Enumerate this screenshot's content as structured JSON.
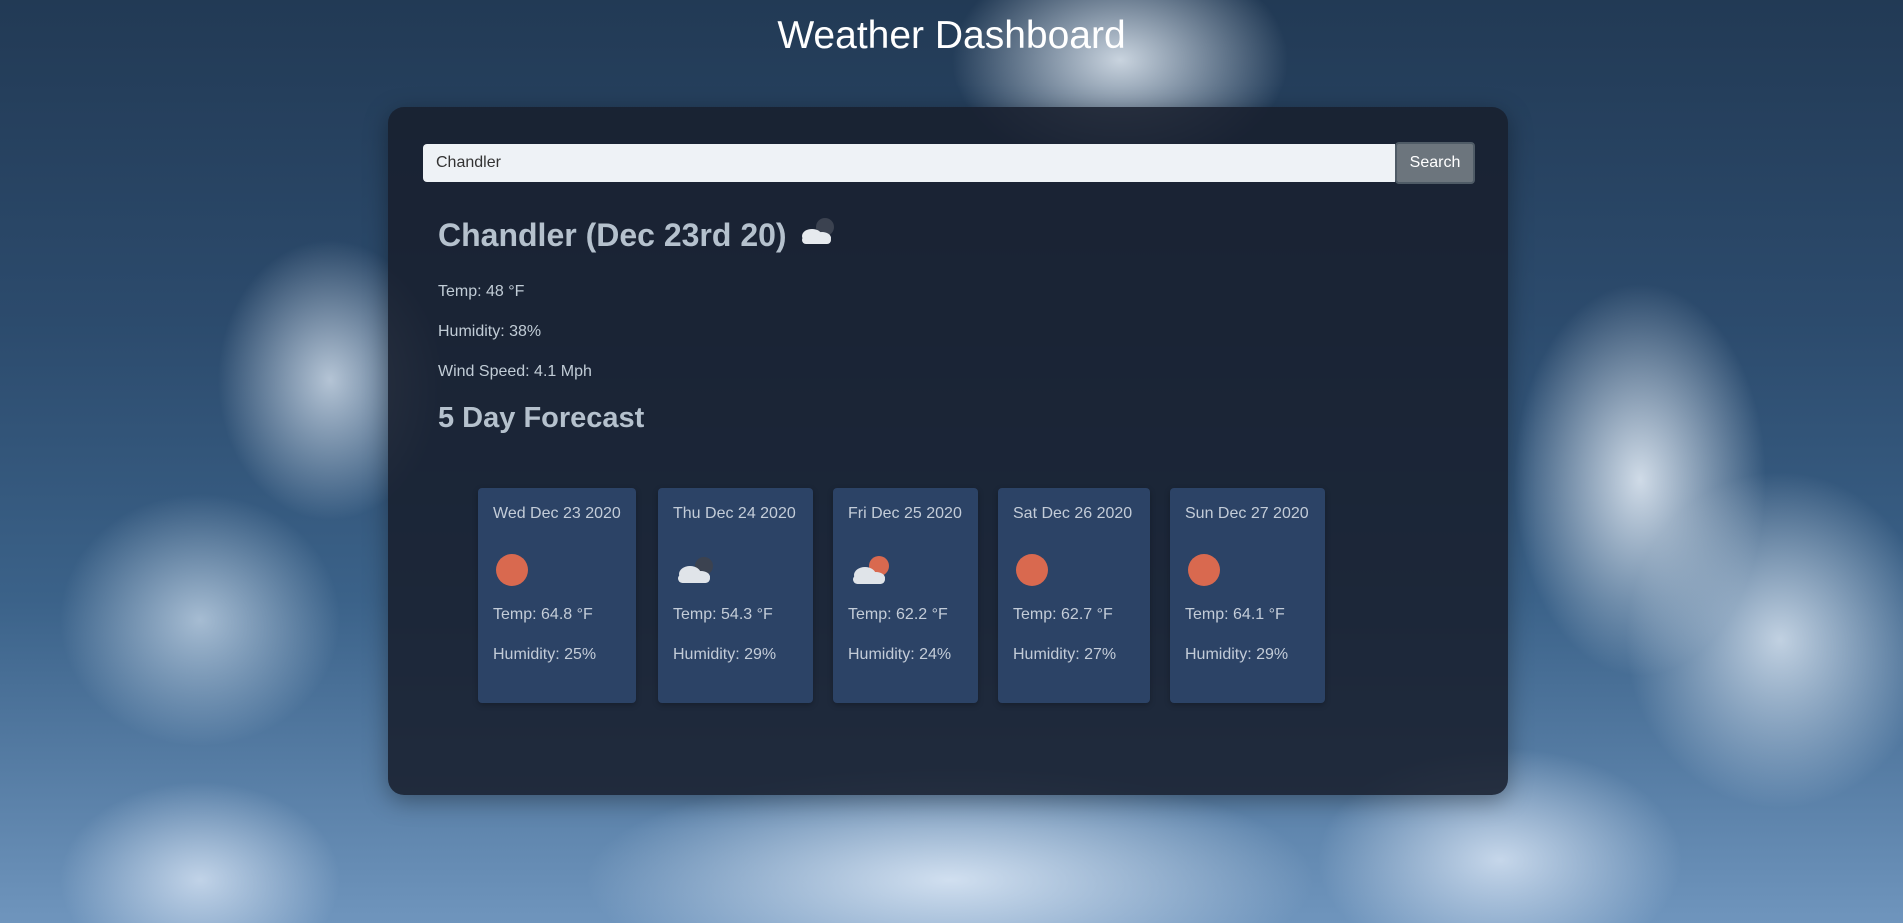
{
  "page": {
    "title": "Weather Dashboard"
  },
  "search": {
    "value": "Chandler",
    "button_label": "Search"
  },
  "current": {
    "heading": "Chandler (Dec 23rd 20)",
    "icon": "cloudy-night-icon",
    "temp": "Temp: 48 °F",
    "humidity": "Humidity: 38%",
    "wind": "Wind Speed: 4.1 Mph"
  },
  "forecast": {
    "heading": "5 Day Forecast",
    "days": [
      {
        "date": "Wed Dec 23 2020",
        "icon": "sun-icon",
        "temp": "Temp: 64.8 °F",
        "humidity": "Humidity: 25%"
      },
      {
        "date": "Thu Dec 24 2020",
        "icon": "cloud-icon",
        "temp": "Temp: 54.3 °F",
        "humidity": "Humidity: 29%"
      },
      {
        "date": "Fri Dec 25 2020",
        "icon": "partly-cloudy-icon",
        "temp": "Temp: 62.2 °F",
        "humidity": "Humidity: 24%"
      },
      {
        "date": "Sat Dec 26 2020",
        "icon": "sun-icon",
        "temp": "Temp: 62.7 °F",
        "humidity": "Humidity: 27%"
      },
      {
        "date": "Sun Dec 27 2020",
        "icon": "sun-icon",
        "temp": "Temp: 64.1 °F",
        "humidity": "Humidity: 29%"
      }
    ]
  },
  "colors": {
    "sun": "#d9694f",
    "cloud": "#dfe3e8",
    "card_bg": "#2c4366",
    "panel_bg": "#181f2d"
  }
}
